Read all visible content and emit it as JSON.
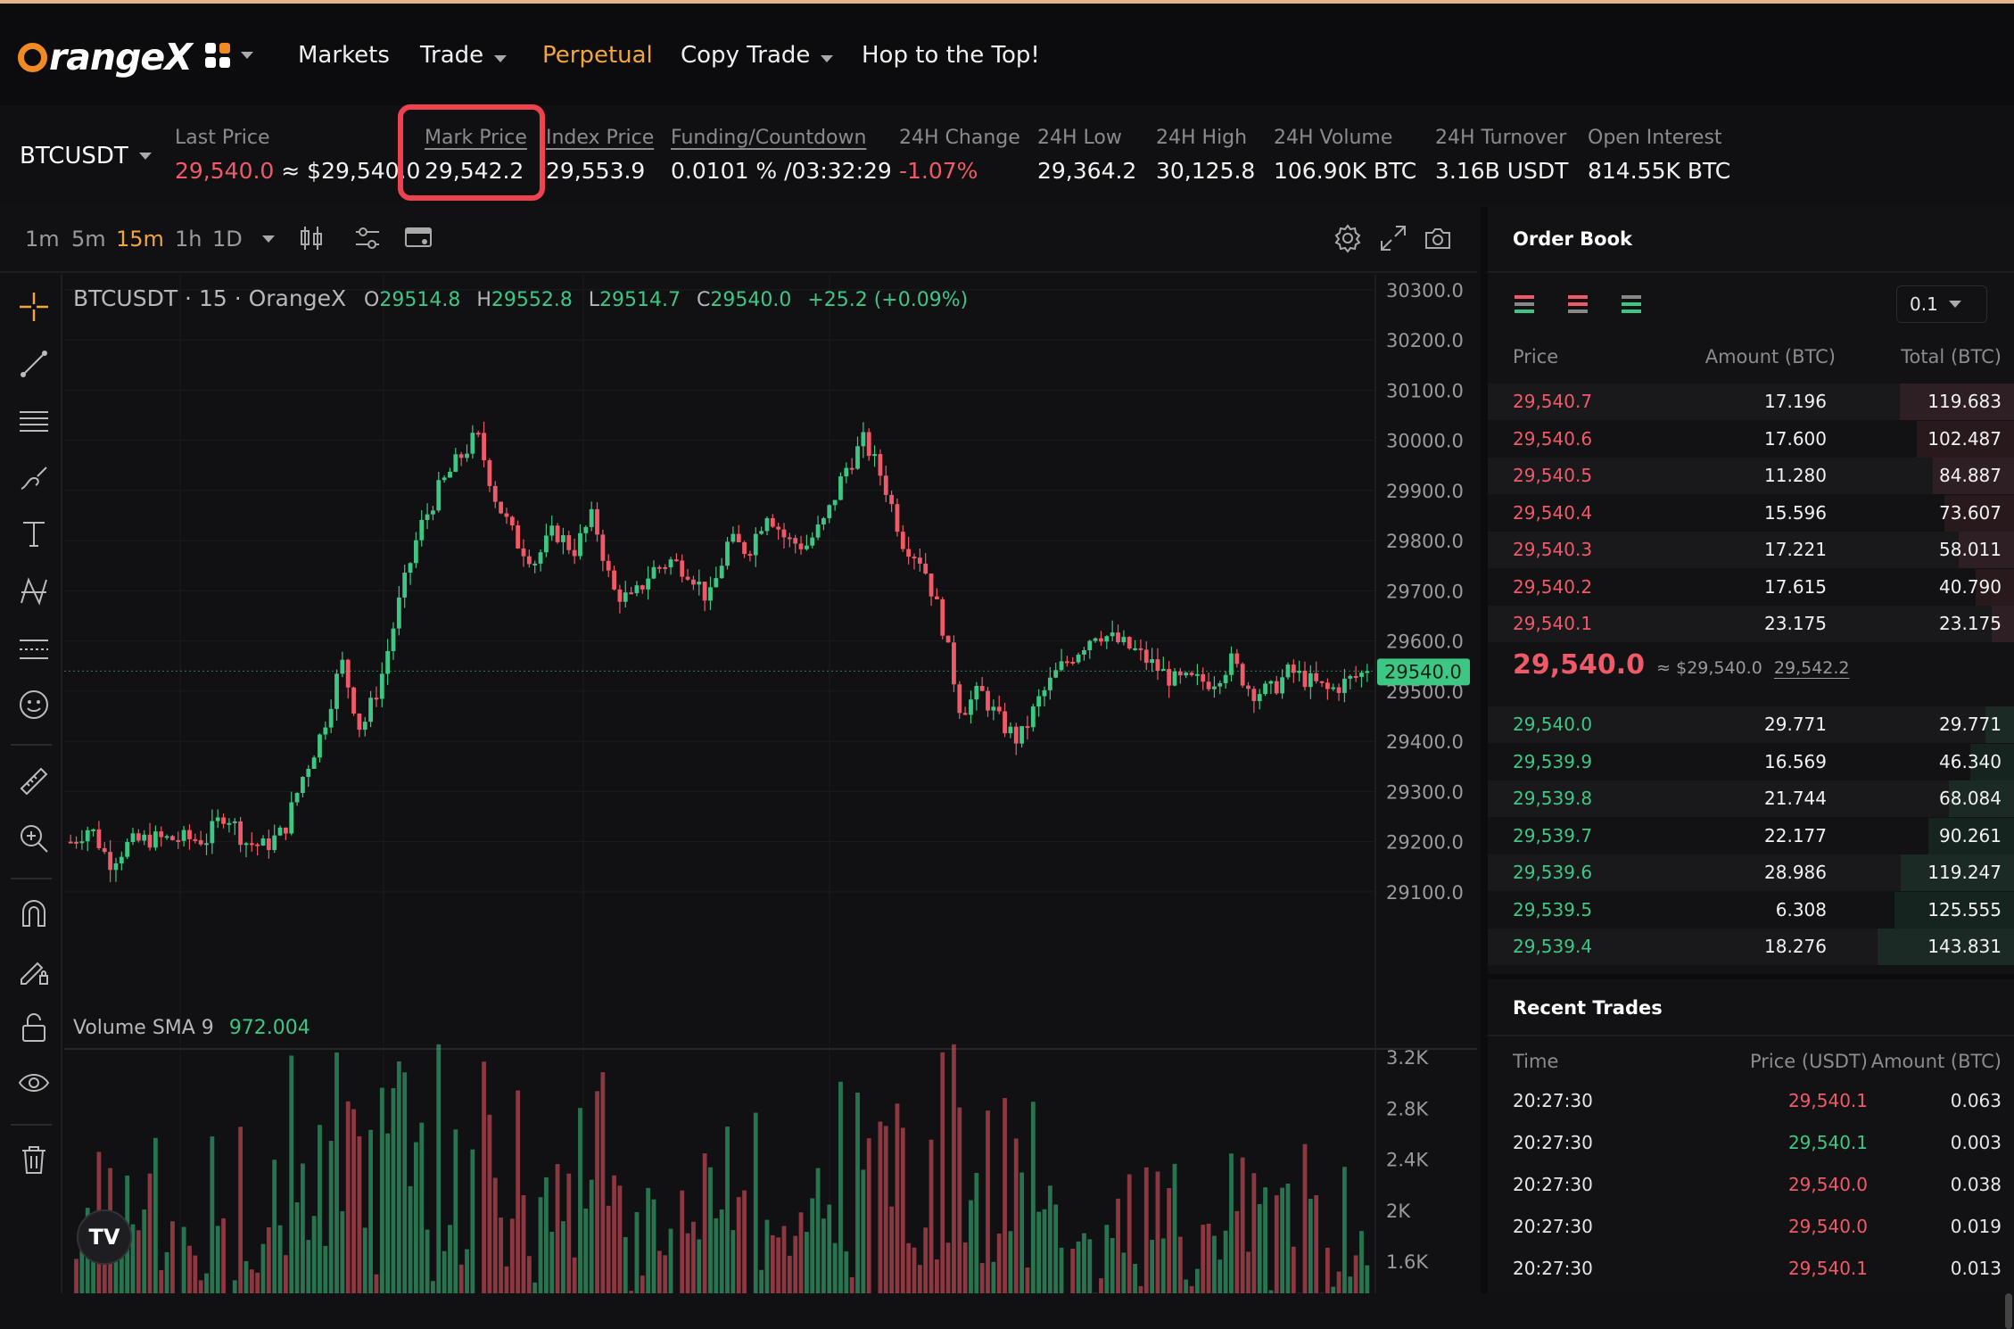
{
  "brand": {
    "logo_text": "rangeX"
  },
  "nav": {
    "items": [
      {
        "label": "Markets",
        "dropdown": false,
        "active": false
      },
      {
        "label": "Trade",
        "dropdown": true,
        "active": false
      },
      {
        "label": "Perpetual",
        "dropdown": false,
        "active": true
      },
      {
        "label": "Copy Trade",
        "dropdown": true,
        "active": false
      },
      {
        "label": "Hop to the Top!",
        "dropdown": false,
        "active": false
      }
    ]
  },
  "ticker": {
    "symbol": "BTCUSDT",
    "last_price": {
      "label": "Last Price",
      "value": "29,540.0",
      "approx": "≈ $29,540.0"
    },
    "mark_price": {
      "label": "Mark Price",
      "value": "29,542.2"
    },
    "index_price": {
      "label": "Index Price",
      "value": "29,553.9"
    },
    "funding": {
      "label": "Funding/Countdown",
      "value": "0.0101 % /03:32:29"
    },
    "change": {
      "label": "24H Change",
      "value": "-1.07%"
    },
    "low": {
      "label": "24H Low",
      "value": "29,364.2"
    },
    "high": {
      "label": "24H High",
      "value": "30,125.8"
    },
    "volume": {
      "label": "24H Volume",
      "value": "106.90K BTC"
    },
    "turnover": {
      "label": "24H Turnover",
      "value": "3.16B USDT"
    },
    "open_interest": {
      "label": "Open Interest",
      "value": "814.55K BTC"
    }
  },
  "chart_toolbar": {
    "timeframes": [
      "1m",
      "5m",
      "15m",
      "1h",
      "1D"
    ],
    "selected_timeframe": "15m"
  },
  "chart": {
    "legend_title": "BTCUSDT · 15 · OrangeX",
    "o_label": "O",
    "o_value": "29514.8",
    "h_label": "H",
    "h_value": "29552.8",
    "l_label": "L",
    "l_value": "29514.7",
    "c_label": "C",
    "c_value": "29540.0",
    "change": "+25.2 (+0.09%)",
    "current_price_tag": "29540.0",
    "volume_label": "Volume SMA 9",
    "volume_value": "972.004",
    "colors": {
      "up": "#3ec784",
      "down": "#f05a68",
      "accent": "#f0a53e"
    }
  },
  "chart_data": [
    {
      "type": "candlestick",
      "title": "BTCUSDT · 15 · OrangeX",
      "ylim": [
        29050,
        30330
      ],
      "yticks": [
        "30300.0",
        "30200.0",
        "30100.0",
        "30000.0",
        "29900.0",
        "29800.0",
        "29700.0",
        "29600.0",
        "29500.0",
        "29400.0",
        "29300.0",
        "29200.0",
        "29100.0"
      ],
      "ytick_values": [
        30300,
        30200,
        30100,
        30000,
        29900,
        29800,
        29700,
        29600,
        29500,
        29400,
        29300,
        29200,
        29100
      ],
      "close_path": [
        29200,
        29230,
        29160,
        29195,
        29205,
        29205,
        29205,
        29205,
        29260,
        29200,
        29190,
        29220,
        29330,
        29420,
        29560,
        29420,
        29520,
        29680,
        29820,
        29900,
        29960,
        30010,
        29880,
        29800,
        29760,
        29820,
        29780,
        29850,
        29700,
        29680,
        29740,
        29760,
        29740,
        29680,
        29800,
        29780,
        29860,
        29800,
        29790,
        29840,
        29940,
        30000,
        29920,
        29800,
        29760,
        29640,
        29460,
        29500,
        29440,
        29400,
        29480,
        29540,
        29580,
        29620,
        29600,
        29580,
        29550,
        29520,
        29520,
        29520,
        29560,
        29500,
        29500,
        29540,
        29520,
        29500,
        29520,
        29540
      ]
    },
    {
      "type": "bar",
      "title": "Volume SMA 9",
      "yticks": [
        "3.2K",
        "2.8K",
        "2.4K",
        "2K",
        "1.6K"
      ],
      "ytick_values": [
        3200,
        2800,
        2400,
        2000,
        1600
      ],
      "ylim": [
        1350,
        3250
      ]
    }
  ],
  "order_book": {
    "title": "Order Book",
    "precision": "0.1",
    "headers": {
      "price": "Price",
      "amount": "Amount (BTC)",
      "total": "Total (BTC)"
    },
    "asks": [
      {
        "price": "29,540.7",
        "amount": "17.196",
        "total": "119.683"
      },
      {
        "price": "29,540.6",
        "amount": "17.600",
        "total": "102.487"
      },
      {
        "price": "29,540.5",
        "amount": "11.280",
        "total": "84.887"
      },
      {
        "price": "29,540.4",
        "amount": "15.596",
        "total": "73.607"
      },
      {
        "price": "29,540.3",
        "amount": "17.221",
        "total": "58.011"
      },
      {
        "price": "29,540.2",
        "amount": "17.615",
        "total": "40.790"
      },
      {
        "price": "29,540.1",
        "amount": "23.175",
        "total": "23.175"
      }
    ],
    "mid": {
      "price": "29,540.0",
      "approx": "≈ $29,540.0",
      "mark": "29,542.2"
    },
    "bids": [
      {
        "price": "29,540.0",
        "amount": "29.771",
        "total": "29.771"
      },
      {
        "price": "29,539.9",
        "amount": "16.569",
        "total": "46.340"
      },
      {
        "price": "29,539.8",
        "amount": "21.744",
        "total": "68.084"
      },
      {
        "price": "29,539.7",
        "amount": "22.177",
        "total": "90.261"
      },
      {
        "price": "29,539.6",
        "amount": "28.986",
        "total": "119.247"
      },
      {
        "price": "29,539.5",
        "amount": "6.308",
        "total": "125.555"
      },
      {
        "price": "29,539.4",
        "amount": "18.276",
        "total": "143.831"
      }
    ]
  },
  "recent_trades": {
    "title": "Recent Trades",
    "headers": {
      "time": "Time",
      "price": "Price (USDT)",
      "amount": "Amount (BTC)"
    },
    "rows": [
      {
        "time": "20:27:30",
        "price": "29,540.1",
        "amount": "0.063",
        "side": "sell"
      },
      {
        "time": "20:27:30",
        "price": "29,540.1",
        "amount": "0.003",
        "side": "buy"
      },
      {
        "time": "20:27:30",
        "price": "29,540.0",
        "amount": "0.038",
        "side": "sell"
      },
      {
        "time": "20:27:30",
        "price": "29,540.0",
        "amount": "0.019",
        "side": "sell"
      },
      {
        "time": "20:27:30",
        "price": "29,540.1",
        "amount": "0.013",
        "side": "sell"
      }
    ]
  }
}
